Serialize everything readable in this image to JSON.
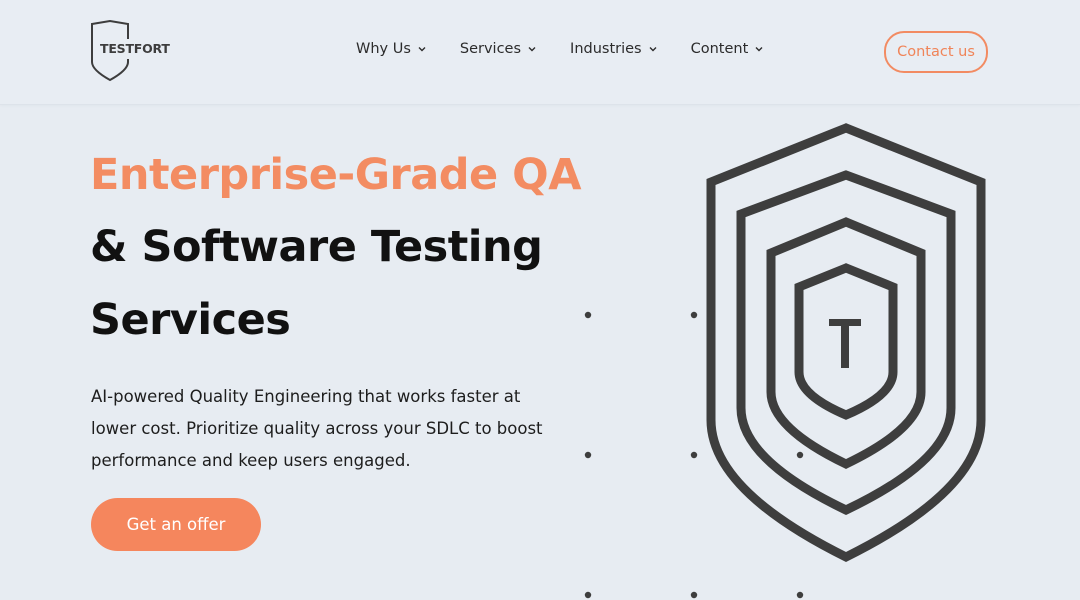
{
  "header": {
    "logo_text": "TESTFORT",
    "nav": [
      {
        "label": "Why Us"
      },
      {
        "label": "Services"
      },
      {
        "label": "Industries"
      },
      {
        "label": "Content"
      }
    ],
    "contact_label": "Contact us"
  },
  "hero": {
    "title_line1": "Enterprise-Grade QA",
    "title_line2": "& Software Testing",
    "title_line3": "Services",
    "description": "AI-powered Quality Engineering that works faster at lower cost. Prioritize quality across your SDLC to boost performance and keep users engaged.",
    "cta_label": "Get an offer",
    "shield_letter": "T"
  },
  "colors": {
    "accent": "#f38c62",
    "background": "#e7ecf2",
    "text": "#111111",
    "shield": "#3e3e3e"
  }
}
